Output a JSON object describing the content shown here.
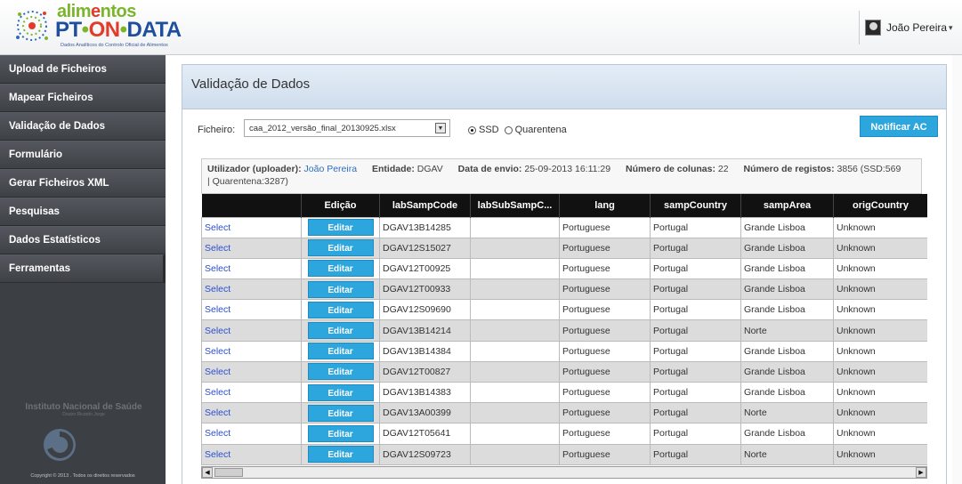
{
  "header": {
    "logo_line1_a": "alim",
    "logo_line1_b": "e",
    "logo_line1_c": "ntos",
    "logo_line2_a": "PT",
    "logo_line2_dot": "•",
    "logo_line2_on": "ON",
    "logo_line2_c": "DATA",
    "logo_tagline": "Dados Analíticos do Controlo Oficial de Alimentos",
    "user_name": "João Pereira",
    "user_caret": "▾"
  },
  "sidebar": {
    "items": [
      {
        "label": "Upload de Ficheiros"
      },
      {
        "label": "Mapear Ficheiros"
      },
      {
        "label": "Validação de Dados"
      },
      {
        "label": "Formulário"
      },
      {
        "label": "Gerar Ficheiros XML"
      },
      {
        "label": "Pesquisas"
      },
      {
        "label": "Dados Estatísticos"
      },
      {
        "label": "Ferramentas"
      }
    ],
    "brand_line1": "Instituto Nacional de Saúde",
    "brand_line2": "Doutor Ricardo Jorge",
    "copyright": "Copyright © 2013 . Todos os direitos reservados"
  },
  "main": {
    "title": "Validação de Dados",
    "file_label": "Ficheiro:",
    "file_value": "caa_2012_versão_final_20130925.xlsx",
    "radio_ssd": "SSD",
    "radio_quarentena": "Quarentena",
    "notify_button": "Notificar AC",
    "info": {
      "uploader_label": "Utilizador (uploader):",
      "uploader_value": "João Pereira",
      "entity_label": "Entidade:",
      "entity_value": "DGAV",
      "date_label": "Data de envio:",
      "date_value": "25-09-2013 16:11:29",
      "cols_label": "Número de colunas:",
      "cols_value": "22",
      "regs_label": "Número de registos:",
      "regs_value": "3856 (SSD:569",
      "regs_value2": "| Quarentena:3287)"
    }
  },
  "table": {
    "columns": [
      "",
      "Edição",
      "labSampCode",
      "labSubSampC...",
      "lang",
      "sampCountry",
      "sampArea",
      "origCountry"
    ],
    "select_label": "Select",
    "edit_label": "Editar",
    "rows": [
      {
        "code": "DGAV13B14285",
        "sub": "",
        "lang": "Portuguese",
        "country": "Portugal",
        "area": "Grande Lisboa",
        "orig": "Unknown"
      },
      {
        "code": "DGAV12S15027",
        "sub": "",
        "lang": "Portuguese",
        "country": "Portugal",
        "area": "Grande Lisboa",
        "orig": "Unknown"
      },
      {
        "code": "DGAV12T00925",
        "sub": "",
        "lang": "Portuguese",
        "country": "Portugal",
        "area": "Grande Lisboa",
        "orig": "Unknown"
      },
      {
        "code": "DGAV12T00933",
        "sub": "",
        "lang": "Portuguese",
        "country": "Portugal",
        "area": "Grande Lisboa",
        "orig": "Unknown"
      },
      {
        "code": "DGAV12S09690",
        "sub": "",
        "lang": "Portuguese",
        "country": "Portugal",
        "area": "Grande Lisboa",
        "orig": "Unknown"
      },
      {
        "code": "DGAV13B14214",
        "sub": "",
        "lang": "Portuguese",
        "country": "Portugal",
        "area": "Norte",
        "orig": "Unknown"
      },
      {
        "code": "DGAV13B14384",
        "sub": "",
        "lang": "Portuguese",
        "country": "Portugal",
        "area": "Grande Lisboa",
        "orig": "Unknown"
      },
      {
        "code": "DGAV12T00827",
        "sub": "",
        "lang": "Portuguese",
        "country": "Portugal",
        "area": "Grande Lisboa",
        "orig": "Unknown"
      },
      {
        "code": "DGAV13B14383",
        "sub": "",
        "lang": "Portuguese",
        "country": "Portugal",
        "area": "Grande Lisboa",
        "orig": "Unknown"
      },
      {
        "code": "DGAV13A00399",
        "sub": "",
        "lang": "Portuguese",
        "country": "Portugal",
        "area": "Norte",
        "orig": "Unknown"
      },
      {
        "code": "DGAV12T05641",
        "sub": "",
        "lang": "Portuguese",
        "country": "Portugal",
        "area": "Grande Lisboa",
        "orig": "Unknown"
      },
      {
        "code": "DGAV12S09723",
        "sub": "",
        "lang": "Portuguese",
        "country": "Portugal",
        "area": "Norte",
        "orig": "Unknown"
      }
    ]
  },
  "colors": {
    "accent_button": "#2da6de",
    "sidebar_bg": "#3c3f44",
    "table_header": "#111111",
    "link": "#2b4fd0"
  }
}
